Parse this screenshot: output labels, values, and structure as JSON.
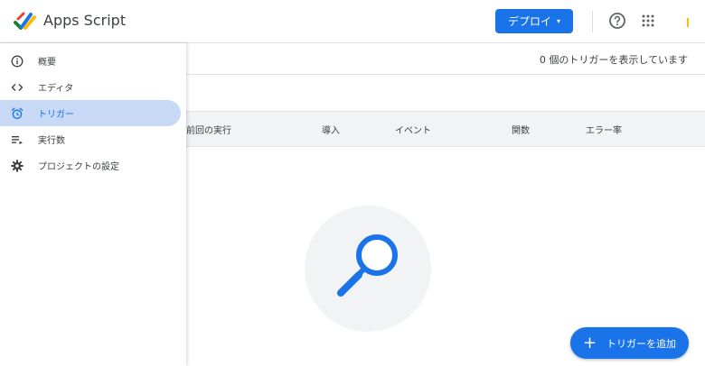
{
  "header": {
    "app_title": "Apps Script",
    "deploy_label": "デプロイ",
    "deploy_caret": "▾",
    "help_icon": "help-circle-icon",
    "apps_icon": "apps-grid-icon"
  },
  "sidebar": {
    "items": [
      {
        "label": "概要",
        "icon": "info-icon",
        "active": false
      },
      {
        "label": "エディタ",
        "icon": "code-icon",
        "active": false
      },
      {
        "label": "トリガー",
        "icon": "alarm-clock-icon",
        "active": true
      },
      {
        "label": "実行数",
        "icon": "executions-icon",
        "active": false
      },
      {
        "label": "プロジェクトの設定",
        "icon": "gear-icon",
        "active": false
      }
    ]
  },
  "main": {
    "status_text": "0 個のトリガーを表示しています",
    "columns": [
      "前回の実行",
      "導入",
      "イベント",
      "関数",
      "エラー率"
    ],
    "empty_state_icon": "magnifier-icon"
  },
  "fab": {
    "plus": "+",
    "label": "トリガーを追加"
  },
  "colors": {
    "accent": "#1a73e8",
    "active_nav_bg": "#c7d9f5",
    "empty_circle": "#f1f3f4"
  }
}
